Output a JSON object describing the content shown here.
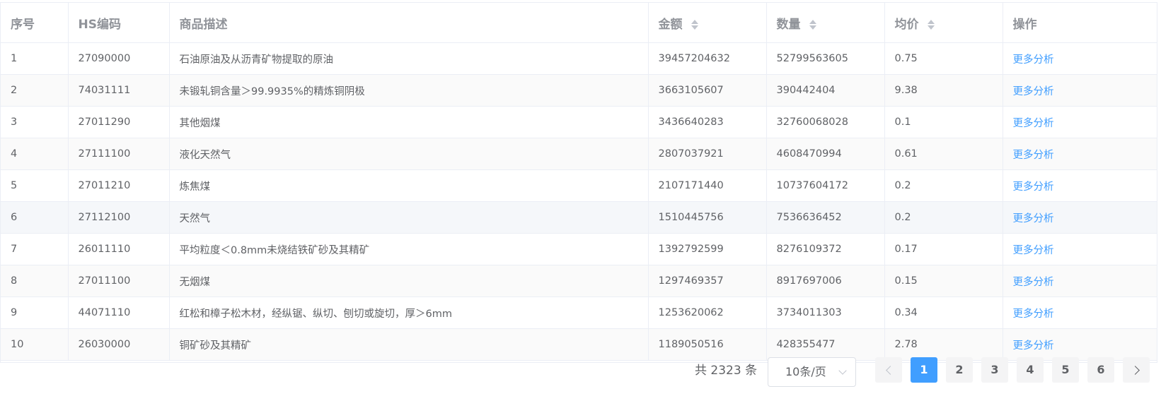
{
  "table": {
    "headers": {
      "index": "序号",
      "hs": "HS编码",
      "desc": "商品描述",
      "amount": "金额",
      "quantity": "数量",
      "avg": "均价",
      "action": "操作"
    },
    "rows": [
      {
        "index": "1",
        "hs": "27090000",
        "desc": "石油原油及从沥青矿物提取的原油",
        "amount": "39457204632",
        "quantity": "52799563605",
        "avg": "0.75",
        "action": "更多分析"
      },
      {
        "index": "2",
        "hs": "74031111",
        "desc": "未锻轧铜含量＞99.9935%的精炼铜阴极",
        "amount": "3663105607",
        "quantity": "390442404",
        "avg": "9.38",
        "action": "更多分析"
      },
      {
        "index": "3",
        "hs": "27011290",
        "desc": "其他烟煤",
        "amount": "3436640283",
        "quantity": "32760068028",
        "avg": "0.1",
        "action": "更多分析"
      },
      {
        "index": "4",
        "hs": "27111100",
        "desc": "液化天然气",
        "amount": "2807037921",
        "quantity": "4608470994",
        "avg": "0.61",
        "action": "更多分析"
      },
      {
        "index": "5",
        "hs": "27011210",
        "desc": "炼焦煤",
        "amount": "2107171440",
        "quantity": "10737604172",
        "avg": "0.2",
        "action": "更多分析"
      },
      {
        "index": "6",
        "hs": "27112100",
        "desc": "天然气",
        "amount": "1510445756",
        "quantity": "7536636452",
        "avg": "0.2",
        "action": "更多分析"
      },
      {
        "index": "7",
        "hs": "26011110",
        "desc": "平均粒度＜0.8mm未烧结铁矿砂及其精矿",
        "amount": "1392792599",
        "quantity": "8276109372",
        "avg": "0.17",
        "action": "更多分析"
      },
      {
        "index": "8",
        "hs": "27011100",
        "desc": "无烟煤",
        "amount": "1297469357",
        "quantity": "8917697006",
        "avg": "0.15",
        "action": "更多分析"
      },
      {
        "index": "9",
        "hs": "44071110",
        "desc": "红松和樟子松木材，经纵锯、纵切、刨切或旋切，厚＞6mm",
        "amount": "1253620062",
        "quantity": "3734011303",
        "avg": "0.34",
        "action": "更多分析"
      },
      {
        "index": "10",
        "hs": "26030000",
        "desc": "铜矿砂及其精矿",
        "amount": "1189050516",
        "quantity": "428355477",
        "avg": "2.78",
        "action": "更多分析"
      }
    ]
  },
  "pagination": {
    "total_text": "共 2323 条",
    "page_size": "10条/页",
    "pages": [
      "1",
      "2",
      "3",
      "4",
      "5",
      "6"
    ],
    "current_page": "1"
  },
  "colors": {
    "accent": "#409eff",
    "header_text": "#909399",
    "body_text": "#606266",
    "border": "#ebeef5",
    "stripe": "#fafafa",
    "hover_row": "#f5f7fa"
  },
  "icons": {
    "sort": "sort-caret-icon",
    "prev": "chevron-left-icon",
    "next": "chevron-right-icon",
    "dropdown": "chevron-down-icon"
  }
}
